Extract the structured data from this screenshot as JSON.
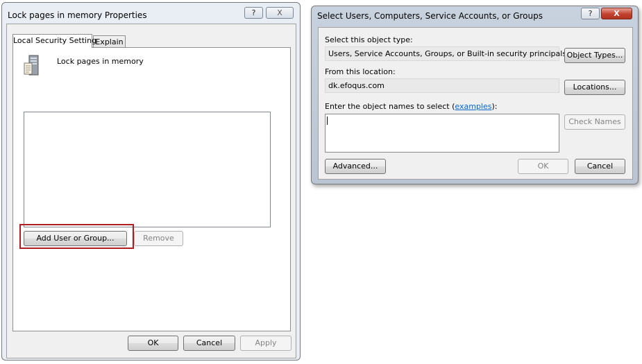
{
  "left_dialog": {
    "title": "Lock pages in memory Properties",
    "help_glyph": "?",
    "close_glyph": "X",
    "tabs": [
      {
        "label": "Local Security Setting"
      },
      {
        "label": "Explain"
      }
    ],
    "policy_icon": "server-policy-icon",
    "policy_name": "Lock pages in memory",
    "add_button": "Add User or Group...",
    "remove_button": "Remove",
    "ok_button": "OK",
    "cancel_button": "Cancel",
    "apply_button": "Apply"
  },
  "right_dialog": {
    "title": "Select Users, Computers, Service Accounts, or Groups",
    "help_glyph": "?",
    "close_glyph": "X",
    "object_type_label": "Select this object type:",
    "object_type_value": "Users, Service Accounts, Groups, or Built-in security principals",
    "object_types_button": "Object Types...",
    "location_label": "From this location:",
    "location_value": "dk.efoqus.com",
    "locations_button": "Locations...",
    "names_label_prefix": "Enter the object names to select (",
    "names_label_link": "examples",
    "names_label_suffix": "):",
    "names_value": "",
    "check_names_button": "Check Names",
    "advanced_button": "Advanced...",
    "ok_button": "OK",
    "cancel_button": "Cancel"
  },
  "colors": {
    "highlight": "#b01c22",
    "link": "#0066cc",
    "close_red": "#c2412e"
  }
}
